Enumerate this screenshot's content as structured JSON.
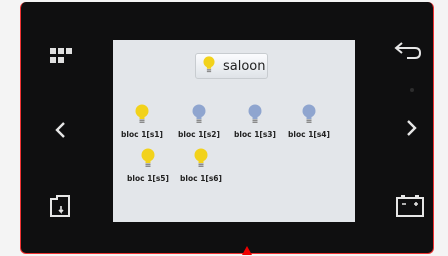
{
  "header": {
    "label": "saloon",
    "icon": "bulb-on-icon"
  },
  "lights": [
    {
      "label": "bloc 1[s1]",
      "state": "on",
      "color": "#f2d21b"
    },
    {
      "label": "bloc 1[s2]",
      "state": "off",
      "color": "#8fa5cf"
    },
    {
      "label": "bloc 1[s3]",
      "state": "off",
      "color": "#8fa5cf"
    },
    {
      "label": "bloc 1[s4]",
      "state": "off",
      "color": "#8fa5cf"
    },
    {
      "label": "bloc 1[s5]",
      "state": "on",
      "color": "#f2d21b"
    },
    {
      "label": "bloc 1[s6]",
      "state": "on",
      "color": "#f2d21b"
    }
  ],
  "buttons": {
    "menu": "grid-icon",
    "back": "return-arrow-icon",
    "left": "chevron-left-icon",
    "right": "chevron-right-icon",
    "save": "sd-card-icon",
    "battery": "battery-icon"
  },
  "colors": {
    "bezel": "#0f0f10",
    "screen": "#e3e6ea",
    "bulb_on": "#f2d21b",
    "bulb_off": "#8fa5cf",
    "indicator": "#e00000"
  }
}
